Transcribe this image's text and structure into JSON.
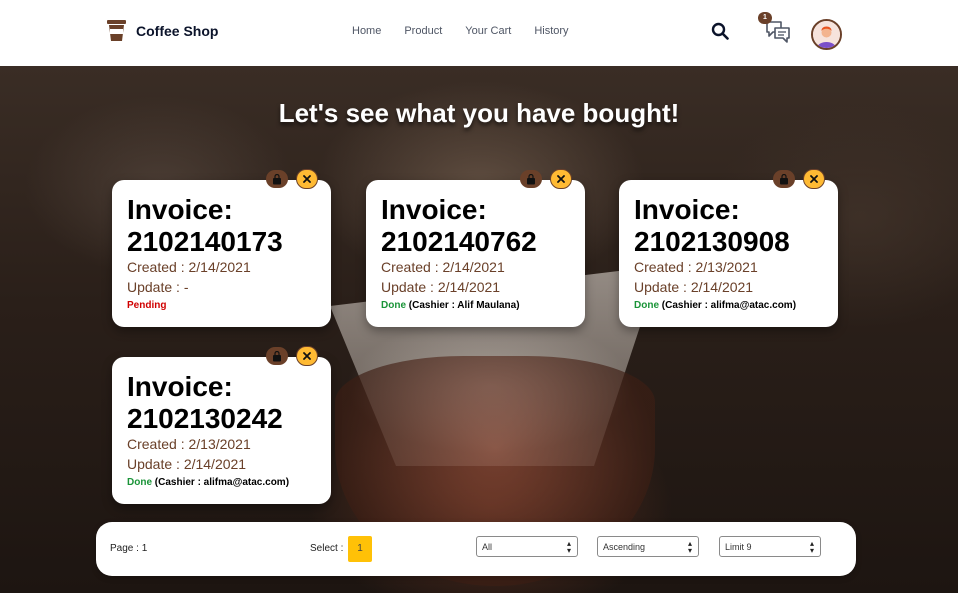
{
  "navbar": {
    "brand": "Coffee Shop",
    "links": [
      "Home",
      "Product",
      "Your Cart",
      "History"
    ],
    "chat_badge": "1"
  },
  "main": {
    "heading": "Let's see what you have bought!"
  },
  "invoices": [
    {
      "title_label": "Invoice:",
      "number": "2102140173",
      "created": "Created : 2/14/2021",
      "updated": "Update : -",
      "status": "Pending",
      "note": ""
    },
    {
      "title_label": "Invoice:",
      "number": "2102140762",
      "created": "Created : 2/14/2021",
      "updated": "Update : 2/14/2021",
      "status": "Done",
      "note": "(Cashier : Alif Maulana)"
    },
    {
      "title_label": "Invoice:",
      "number": "2102130908",
      "created": "Created : 2/13/2021",
      "updated": "Update : 2/14/2021",
      "status": "Done",
      "note": "(Cashier : alifma@atac.com)"
    },
    {
      "title_label": "Invoice:",
      "number": "2102130242",
      "created": "Created : 2/13/2021",
      "updated": "Update : 2/14/2021",
      "status": "Done",
      "note": "(Cashier : alifma@atac.com)"
    }
  ],
  "pagination": {
    "page_label": "Page : 1",
    "select_label": "Select :",
    "current_page": "1",
    "filter_value": "All",
    "sort_value": "Ascending",
    "limit_value": "Limit 9"
  },
  "colors": {
    "brand_brown": "#6a4029",
    "accent_yellow": "#ffba33",
    "pending_red": "#d00000",
    "done_green": "#1a9438"
  },
  "icons": [
    "coffee-cup-icon",
    "search-icon",
    "chat-icon",
    "avatar",
    "shopping-bag-icon",
    "close-icon",
    "caret-up-down-icon"
  ]
}
